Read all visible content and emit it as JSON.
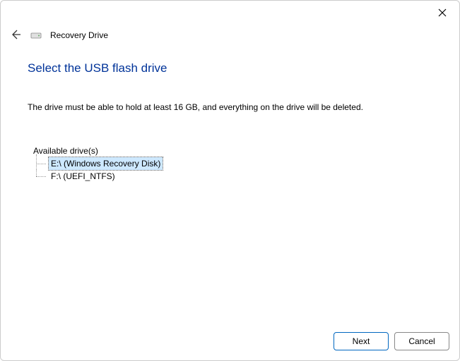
{
  "window": {
    "title": "Recovery Drive"
  },
  "page": {
    "heading": "Select the USB flash drive",
    "description": "The drive must be able to hold at least 16 GB, and everything on the drive will be deleted."
  },
  "drives": {
    "label": "Available drive(s)",
    "items": [
      {
        "text": "E:\\ (Windows Recovery Disk)",
        "selected": true
      },
      {
        "text": "F:\\ (UEFI_NTFS)",
        "selected": false
      }
    ]
  },
  "buttons": {
    "next": "Next",
    "cancel": "Cancel"
  }
}
